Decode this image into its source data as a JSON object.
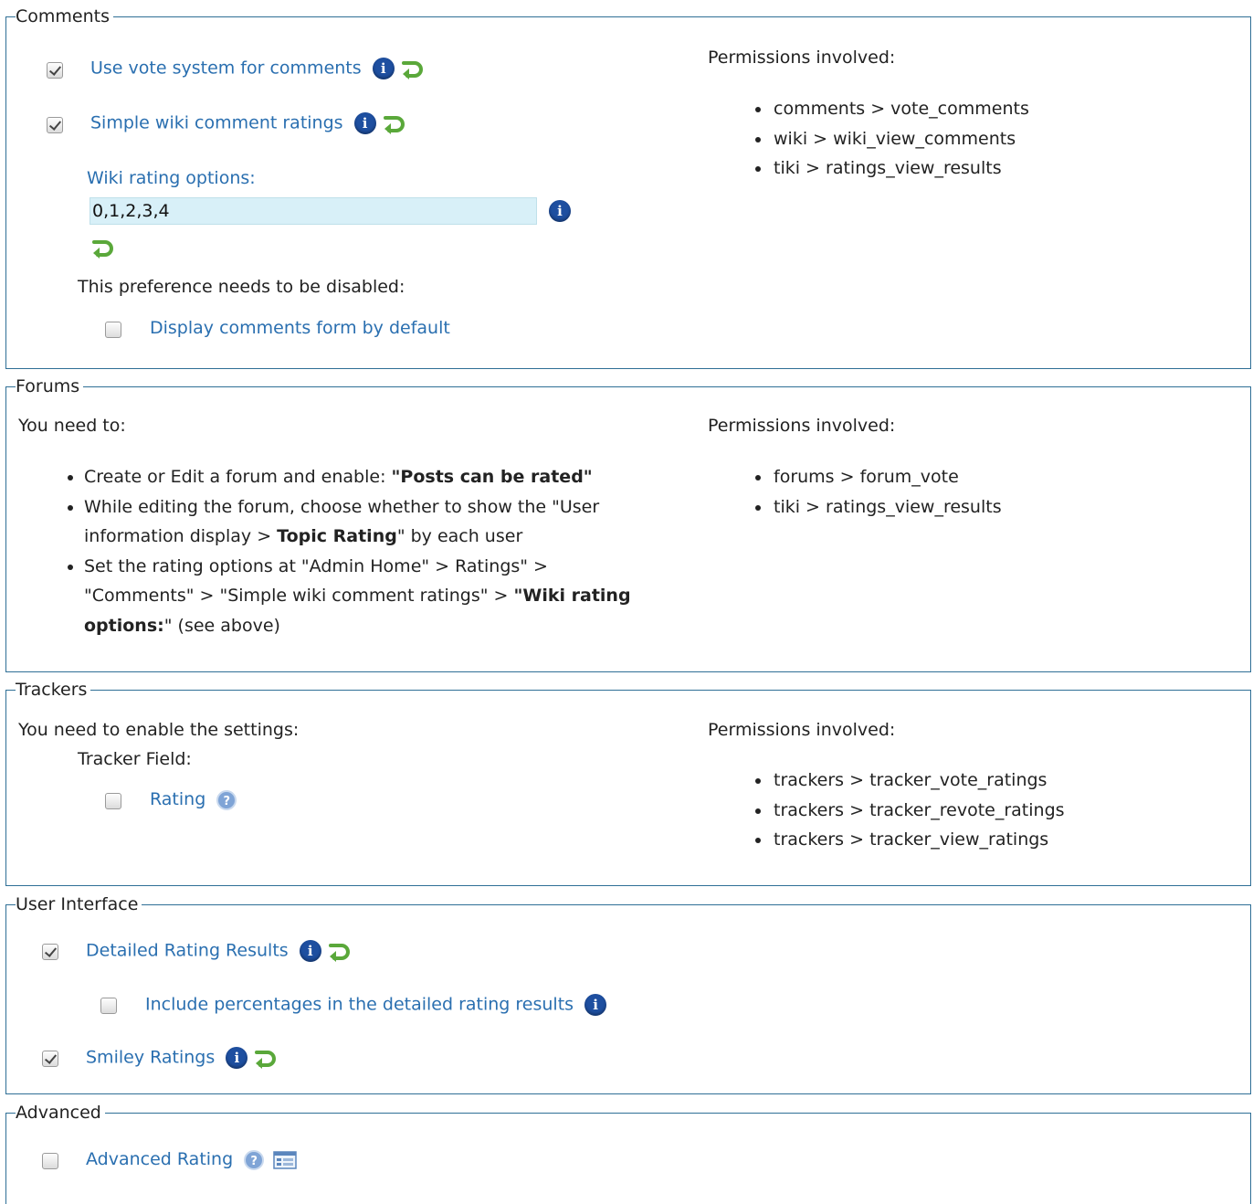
{
  "comments": {
    "legend": "Comments",
    "vote_system": {
      "label": "Use vote system for comments",
      "checked": true
    },
    "simple_wiki_ratings": {
      "label": "Simple wiki comment ratings",
      "checked": true
    },
    "wiki_rating_options": {
      "label": "Wiki rating options:",
      "value": "0,1,2,3,4"
    },
    "disabled_note": "This preference needs to be disabled:",
    "display_form": {
      "label": "Display comments form by default",
      "checked": false
    },
    "permissions_title": "Permissions involved:",
    "permissions": [
      "comments > vote_comments",
      "wiki > wiki_view_comments",
      "tiki > ratings_view_results"
    ]
  },
  "forums": {
    "legend": "Forums",
    "need_to": "You need to:",
    "steps": {
      "s1_pre": "Create or Edit a forum and enable: ",
      "s1_bold": "\"Posts can be rated\"",
      "s2_pre": "While editing the forum, choose whether to show the \"User information display > ",
      "s2_bold": "Topic Rating",
      "s2_post": "\" by each user",
      "s3_pre": "Set the rating options at \"Admin Home\" > Ratings\" > \"Comments\" > \"Simple wiki comment ratings\" > ",
      "s3_bold": "\"Wiki rating options:",
      "s3_post": "\" (see above)"
    },
    "permissions_title": "Permissions involved:",
    "permissions": [
      "forums > forum_vote",
      "tiki > ratings_view_results"
    ]
  },
  "trackers": {
    "legend": "Trackers",
    "need_enable": "You need to enable the settings:",
    "tracker_field": "Tracker Field:",
    "rating": {
      "label": "Rating",
      "checked": false
    },
    "permissions_title": "Permissions involved:",
    "permissions": [
      "trackers > tracker_vote_ratings",
      "trackers > tracker_revote_ratings",
      "trackers > tracker_view_ratings"
    ]
  },
  "user_interface": {
    "legend": "User Interface",
    "detailed": {
      "label": "Detailed Rating Results",
      "checked": true
    },
    "percentages": {
      "label": "Include percentages in the detailed rating results",
      "checked": false
    },
    "smiley": {
      "label": "Smiley Ratings",
      "checked": true
    }
  },
  "advanced": {
    "legend": "Advanced",
    "advanced_rating": {
      "label": "Advanced Rating",
      "checked": false
    }
  },
  "icons": {
    "info": "i",
    "help": "?"
  },
  "colors": {
    "border": "#2f6f96",
    "link": "#2a6fb0",
    "input_bg": "#d8f0f8",
    "info": "#1e4fa0",
    "reset": "#5aa83a"
  }
}
